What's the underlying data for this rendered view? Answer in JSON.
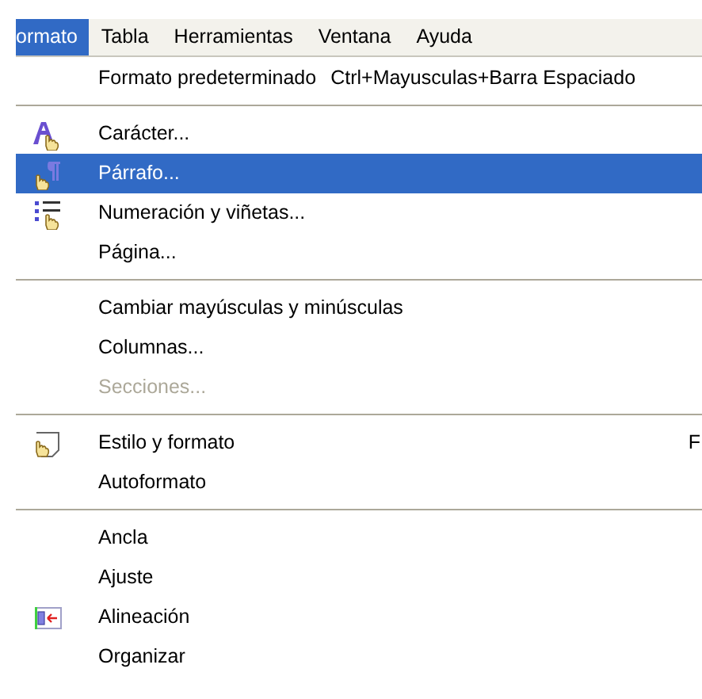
{
  "menubar": [
    {
      "label": "ormato",
      "selected": true
    },
    {
      "label": "Tabla",
      "selected": false
    },
    {
      "label": "Herramientas",
      "selected": false
    },
    {
      "label": "Ventana",
      "selected": false
    },
    {
      "label": "Ayuda",
      "selected": false
    }
  ],
  "menu": {
    "items": [
      {
        "kind": "item",
        "label": "Formato predeterminado",
        "shortcut": "Ctrl+Mayusculas+Barra Espaciado",
        "selected": false,
        "disabled": false
      },
      {
        "kind": "separator"
      },
      {
        "kind": "item",
        "label": "Carácter...",
        "selected": false,
        "disabled": false
      },
      {
        "kind": "item",
        "label": "Párrafo...",
        "selected": true
      },
      {
        "kind": "item",
        "label": "Numeración y viñetas...",
        "selected": false,
        "disabled": false
      },
      {
        "kind": "item",
        "label": "Página...",
        "selected": false,
        "disabled": false
      },
      {
        "kind": "separator"
      },
      {
        "kind": "item",
        "label": "Cambiar mayúsculas y minúsculas",
        "selected": false,
        "disabled": false
      },
      {
        "kind": "item",
        "label": "Columnas...",
        "selected": false,
        "disabled": false
      },
      {
        "kind": "item",
        "label": "Secciones...",
        "selected": false,
        "disabled": true
      },
      {
        "kind": "separator"
      },
      {
        "kind": "item",
        "label": "Estilo y formato",
        "shortcut_right": "F",
        "selected": false,
        "disabled": false
      },
      {
        "kind": "item",
        "label": "Autoformato",
        "selected": false,
        "disabled": false
      },
      {
        "kind": "separator"
      },
      {
        "kind": "item",
        "label": "Ancla",
        "selected": false,
        "disabled": false
      },
      {
        "kind": "item",
        "label": "Ajuste",
        "selected": false,
        "disabled": false
      },
      {
        "kind": "item",
        "label": "Alineación",
        "selected": false,
        "disabled": false
      },
      {
        "kind": "item",
        "label": "Organizar",
        "selected": false,
        "disabled": false
      }
    ]
  }
}
